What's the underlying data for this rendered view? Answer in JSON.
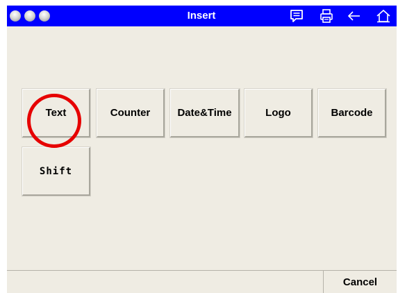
{
  "window": {
    "title": "Insert",
    "titlebar_color": "#0000ff",
    "window_dots": [
      "window-dot",
      "window-dot",
      "window-dot"
    ],
    "toolbar_icons": [
      "message-icon",
      "print-icon",
      "back-arrow-icon",
      "home-icon"
    ]
  },
  "insert_options": [
    {
      "label": "Text"
    },
    {
      "label": "Counter"
    },
    {
      "label": "Date&Time"
    },
    {
      "label": "Logo"
    },
    {
      "label": "Barcode"
    },
    {
      "label": "Shift"
    }
  ],
  "highlight": {
    "target": "Text",
    "color": "#e60000"
  },
  "footer": {
    "cancel_label": "Cancel"
  }
}
